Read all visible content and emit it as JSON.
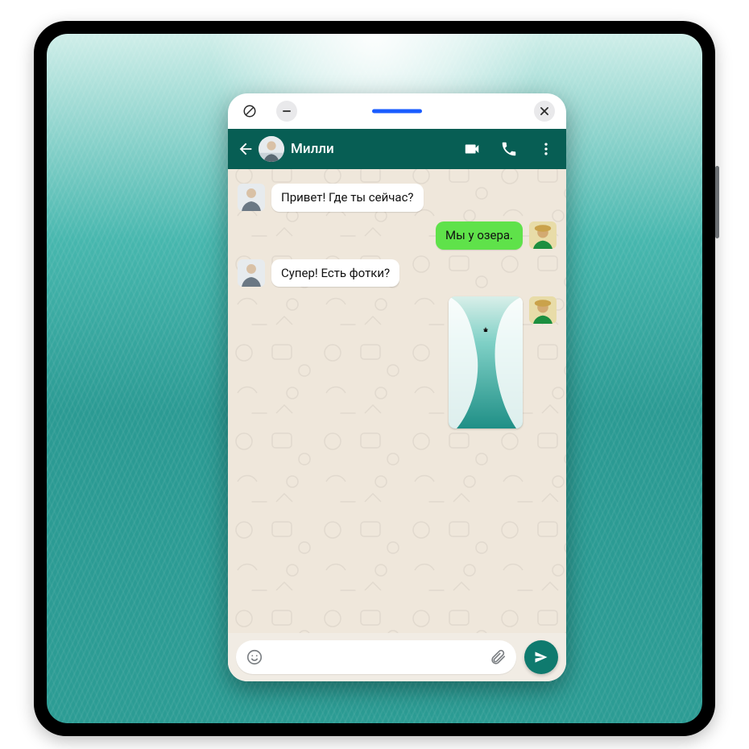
{
  "window": {
    "orient_icon": "orientation-icon",
    "minimize_icon": "minimize-icon",
    "close_icon": "close-icon",
    "handle_color": "#1a5cff"
  },
  "chat": {
    "contact_name": "Милли",
    "header_bg": "#075E54",
    "video_icon": "video-icon",
    "call_icon": "call-icon",
    "menu_icon": "menu-icon"
  },
  "messages": [
    {
      "dir": "in",
      "type": "text",
      "text": "Привет! Где ты сейчас?"
    },
    {
      "dir": "out",
      "type": "text",
      "text": "Мы у озера."
    },
    {
      "dir": "in",
      "type": "text",
      "text": "Супер! Есть фотки?"
    },
    {
      "dir": "out",
      "type": "photo",
      "text": ""
    }
  ],
  "composer": {
    "placeholder": "",
    "value": "",
    "emoji_icon": "emoji-icon",
    "attach_icon": "attach-icon",
    "send_icon": "send-icon"
  },
  "colors": {
    "bubble_in": "#ffffff",
    "bubble_out": "#5fe24a",
    "send_bg": "#0f7a6e",
    "chat_bg": "#efe7db"
  }
}
